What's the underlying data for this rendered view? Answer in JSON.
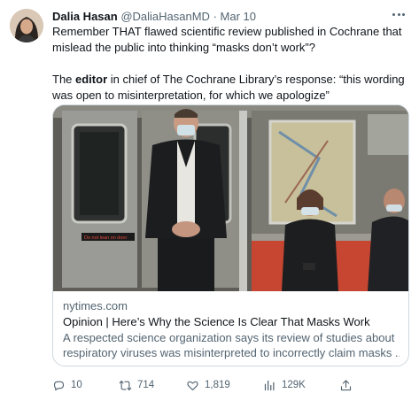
{
  "tweet": {
    "author_name": "Dalia Hasan",
    "author_handle": "@DaliaHasanMD",
    "separator": "·",
    "date": "Mar 10",
    "line1": "Remember THAT flawed scientific review published in Cochrane that mislead the public into thinking “masks don’t work”?",
    "line2_pre": "The ",
    "line2_bold": "editor",
    "line2_post": " in chief of The Cochrane Library’s response: “this wording was open to misinterpretation, for which we apologize”"
  },
  "card": {
    "domain": "nytimes.com",
    "title": "Opinion | Here’s Why the Science Is Clear That Masks Work",
    "desc_line1": "A respected science organization says its review of studies about",
    "desc_line2": "respiratory viruses was misinterpreted to incorrectly claim masks ...",
    "door_sign": "Do not lean on door",
    "image_subject": "subway-passengers-wearing-masks"
  },
  "actions": {
    "replies": "10",
    "retweets": "714",
    "likes": "1,819",
    "views": "129K"
  },
  "icons": {
    "more": "more-horizontal-icon",
    "reply": "reply-icon",
    "retweet": "retweet-icon",
    "like": "heart-icon",
    "views": "views-icon",
    "share": "share-icon"
  },
  "colors": {
    "text": "#0f1419",
    "secondary": "#536471",
    "border": "#cfd9de"
  }
}
